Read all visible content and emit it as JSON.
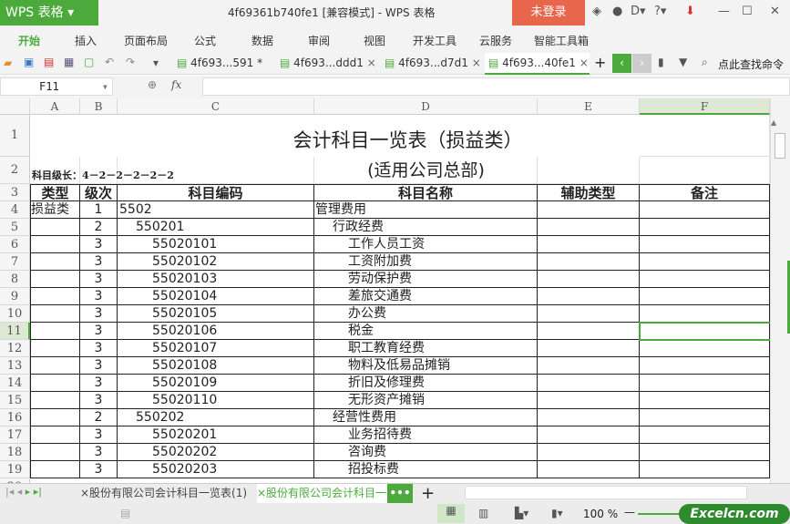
{
  "app": {
    "name": "WPS 表格",
    "title": "4f69361b740fe1 [兼容模式] - WPS 表格",
    "login": "未登录"
  },
  "menu": [
    "开始",
    "插入",
    "页面布局",
    "公式",
    "数据",
    "审阅",
    "视图",
    "开发工具",
    "云服务",
    "智能工具箱"
  ],
  "doc_tabs": [
    {
      "label": "4f693...591 *",
      "active": false
    },
    {
      "label": "4f693...ddd1",
      "active": false
    },
    {
      "label": "4f693...d7d1",
      "active": false
    },
    {
      "label": "4f693...40fe1",
      "active": true
    }
  ],
  "search_label": "点此查找命令",
  "formula": {
    "cell_ref": "F11",
    "fx": "fx",
    "value": ""
  },
  "columns": [
    "A",
    "B",
    "C",
    "D",
    "E",
    "F"
  ],
  "selected_col": "F",
  "selected_row": 11,
  "sheet": {
    "title": "会计科目一览表（损益类）",
    "subtitle": "(适用公司总部)",
    "level_note": "科目级长：4－2－2－2－2－2",
    "headers": [
      "类型",
      "级次",
      "科目编码",
      "科目名称",
      "辅助类型",
      "备注"
    ],
    "rows": [
      {
        "r": 4,
        "type": "损益类",
        "level": "1",
        "code": "5502",
        "name": "管理费用"
      },
      {
        "r": 5,
        "type": "",
        "level": "2",
        "code": "550201",
        "name": "行政经费"
      },
      {
        "r": 6,
        "type": "",
        "level": "3",
        "code": "55020101",
        "name": "工作人员工资"
      },
      {
        "r": 7,
        "type": "",
        "level": "3",
        "code": "55020102",
        "name": "工资附加费"
      },
      {
        "r": 8,
        "type": "",
        "level": "3",
        "code": "55020103",
        "name": "劳动保护费"
      },
      {
        "r": 9,
        "type": "",
        "level": "3",
        "code": "55020104",
        "name": "差旅交通费"
      },
      {
        "r": 10,
        "type": "",
        "level": "3",
        "code": "55020105",
        "name": "办公费"
      },
      {
        "r": 11,
        "type": "",
        "level": "3",
        "code": "55020106",
        "name": "税金"
      },
      {
        "r": 12,
        "type": "",
        "level": "3",
        "code": "55020107",
        "name": "职工教育经费"
      },
      {
        "r": 13,
        "type": "",
        "level": "3",
        "code": "55020108",
        "name": "物料及低易品摊销"
      },
      {
        "r": 14,
        "type": "",
        "level": "3",
        "code": "55020109",
        "name": "折旧及修理费"
      },
      {
        "r": 15,
        "type": "",
        "level": "3",
        "code": "55020110",
        "name": "无形资产摊销"
      },
      {
        "r": 16,
        "type": "",
        "level": "2",
        "code": "550202",
        "name": "经营性费用"
      },
      {
        "r": 17,
        "type": "",
        "level": "3",
        "code": "55020201",
        "name": "业务招待费"
      },
      {
        "r": 18,
        "type": "",
        "level": "3",
        "code": "55020202",
        "name": "咨询费"
      },
      {
        "r": 19,
        "type": "",
        "level": "3",
        "code": "55020203",
        "name": "招投标费"
      }
    ]
  },
  "sheet_tabs": [
    {
      "label": "×股份有限公司会计科目一览表(1)",
      "active": false
    },
    {
      "label": "×股份有限公司会计科目一",
      "active": true
    }
  ],
  "more": "•••",
  "add": "+",
  "zoom": "100 %",
  "watermark": "Excelcn.com"
}
